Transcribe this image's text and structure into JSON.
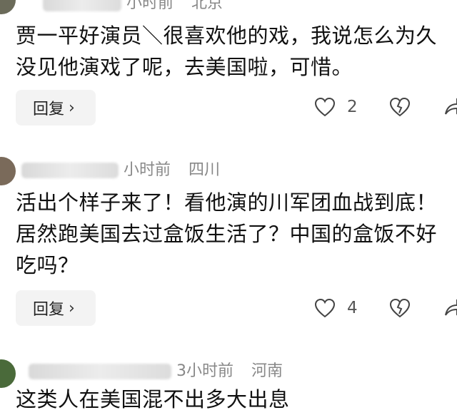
{
  "comments": [
    {
      "time": "小时前",
      "region": "北京",
      "text": "贾一平好演员＼很喜欢他的戏，我说怎么为久没见他演戏了呢，去美国啦，可惜。",
      "reply_label": "回复",
      "like_count": "2"
    },
    {
      "time": "小时前",
      "region": "四川",
      "text": "活出个样子来了！看他演的川军团血战到底！居然跑美国去过盒饭生活了？中国的盒饭不好吃吗？",
      "reply_label": "回复",
      "like_count": "4"
    },
    {
      "time": "3小时前",
      "region": "河南",
      "text": "这类人在美国混不出多大出息"
    }
  ],
  "icons": {
    "like": "heart-outline-icon",
    "dislike": "broken-heart-icon",
    "share": "share-arrow-icon",
    "chevron": "chevron-right-icon"
  }
}
